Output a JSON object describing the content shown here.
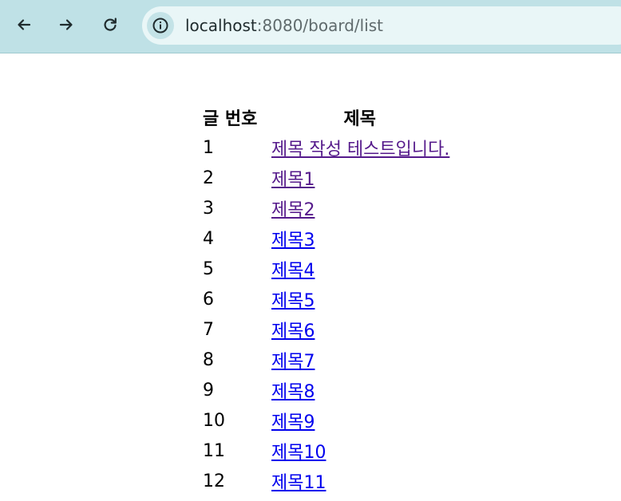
{
  "browser": {
    "back_icon": "arrow-left-icon",
    "forward_icon": "arrow-right-icon",
    "reload_icon": "reload-icon",
    "site_info_icon": "info-icon",
    "url_host": "localhost",
    "url_rest": ":8080/board/list",
    "colors": {
      "toolbar": "#bfe1e6",
      "omnibox": "#e9f6f7"
    }
  },
  "board": {
    "headers": {
      "number": "글 번호",
      "title": "제목"
    },
    "rows": [
      {
        "number": "1",
        "title": "제목 작성 테스트입니다.",
        "visited": true
      },
      {
        "number": "2",
        "title": "제목1",
        "visited": true
      },
      {
        "number": "3",
        "title": "제목2",
        "visited": true
      },
      {
        "number": "4",
        "title": "제목3",
        "visited": false
      },
      {
        "number": "5",
        "title": "제목4",
        "visited": false
      },
      {
        "number": "6",
        "title": "제목5",
        "visited": false
      },
      {
        "number": "7",
        "title": "제목6",
        "visited": false
      },
      {
        "number": "8",
        "title": "제목7",
        "visited": false
      },
      {
        "number": "9",
        "title": "제목8",
        "visited": false
      },
      {
        "number": "10",
        "title": "제목9",
        "visited": false
      },
      {
        "number": "11",
        "title": "제목10",
        "visited": false
      },
      {
        "number": "12",
        "title": "제목11",
        "visited": false
      }
    ],
    "colors": {
      "link": "#0000ee",
      "visited_link": "#551a8b"
    }
  }
}
